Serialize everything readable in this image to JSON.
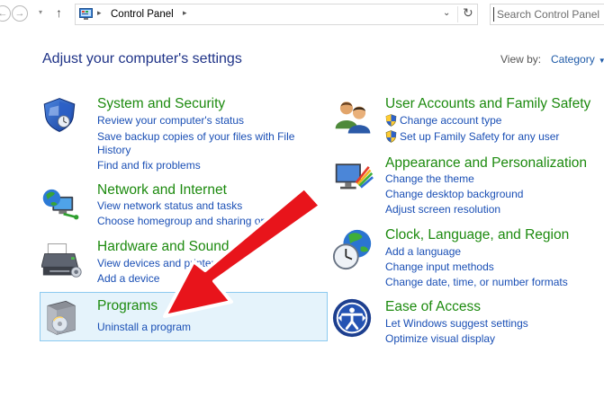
{
  "nav": {
    "back_glyph": "←",
    "forward_glyph": "→",
    "recent_glyph": "▾",
    "up_glyph": "↑",
    "breadcrumb": "Control Panel",
    "crumb_sep": "▸",
    "address_dropdown_glyph": "⌄",
    "refresh_glyph": "↻",
    "search_placeholder": "Search Control Panel"
  },
  "page": {
    "heading": "Adjust your computer's settings",
    "view_by_label": "View by:",
    "view_by_value": "Category",
    "view_by_glyph": "▼"
  },
  "categories": [
    {
      "title": "System and Security",
      "icon": "shield-icon",
      "links": [
        "Review your computer's status",
        "Save backup copies of your files with File",
        "History",
        "Find and fix problems"
      ]
    },
    {
      "title": "Network and Internet",
      "icon": "network-globe-icon",
      "links": [
        "View network status and tasks",
        "Choose homegroup and sharing options"
      ]
    },
    {
      "title": "Hardware and Sound",
      "icon": "printer-icon",
      "links": [
        "View devices and printers",
        "Add a device"
      ]
    },
    {
      "title": "Programs",
      "icon": "programs-box-icon",
      "links": [
        "Uninstall a program"
      ]
    },
    {
      "title": "User Accounts and Family Safety",
      "icon": "users-icon",
      "links": [
        "Change account type",
        "Set up Family Safety for any user"
      ]
    },
    {
      "title": "Appearance and Personalization",
      "icon": "monitor-paint-icon",
      "links": [
        "Change the theme",
        "Change desktop background",
        "Adjust screen resolution"
      ]
    },
    {
      "title": "Clock, Language, and Region",
      "icon": "clock-globe-icon",
      "links": [
        "Add a language",
        "Change input methods",
        "Change date, time, or number formats"
      ]
    },
    {
      "title": "Ease of Access",
      "icon": "ease-of-access-icon",
      "links": [
        "Let Windows suggest settings",
        "Optimize visual display"
      ]
    }
  ],
  "colors": {
    "heading": "#1e3287",
    "category_title": "#1c8a0e",
    "link": "#1a4fb5",
    "highlight_bg": "#e5f3fb",
    "highlight_border": "#8ccaf0",
    "arrow": "#e8141b"
  }
}
